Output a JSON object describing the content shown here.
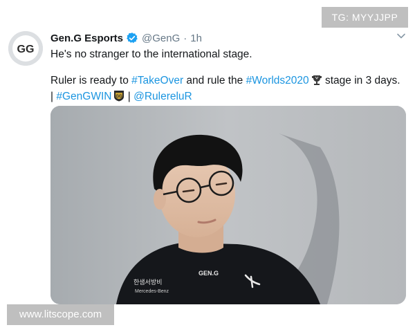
{
  "tweet": {
    "display_name": "Gen.G Esports",
    "handle": "@GenG",
    "separator": "·",
    "time": "1h",
    "line1": "He's no stranger to the international stage.",
    "line2_prefix": "Ruler is ready to ",
    "hashtag_takeover": "#TakeOver",
    "line2_mid": " and rule the ",
    "hashtag_worlds": "#Worlds2020",
    "line2_suffix": " stage in 3 days. | ",
    "hashtag_genGwin": "#GenGWIN",
    "divider": " | ",
    "mention": "@RulereluR",
    "avatar_logo": "GG",
    "jersey_brand": "GEN.G",
    "sponsor_korean": "한샘서방비",
    "sponsor_english": "Mercedes-Benz"
  },
  "watermarks": {
    "tg": "TG: MYYJJPP",
    "site": "www.litscope.com"
  },
  "colors": {
    "link": "#1b95e0",
    "verified": "#1da1f2",
    "muted": "#657786"
  },
  "icons": {
    "verified": "verified-badge-icon",
    "chevron": "chevron-down-icon",
    "worlds": "worlds-trophy-icon",
    "geng": "geng-logo-icon"
  }
}
